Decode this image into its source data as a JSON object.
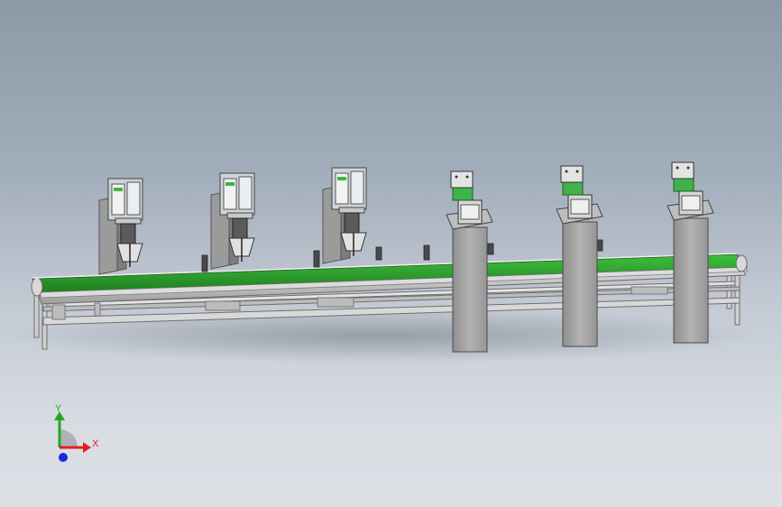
{
  "viewport": {
    "background_top": "#8e99a8",
    "background_bottom": "#dcdfe4"
  },
  "assembly": {
    "conveyor_belt_color": "#2e9a2e",
    "frame_color": "#c9c9c9",
    "column_color": "#a9a9a9",
    "fixture_accent_color": "#3fb34a",
    "gripper_stations": 3,
    "press_stations": 3
  },
  "triad": {
    "x_label": "X",
    "y_label": "Y",
    "x_color": "#e02020",
    "y_color": "#22a822",
    "z_color": "#1a2ad8"
  }
}
